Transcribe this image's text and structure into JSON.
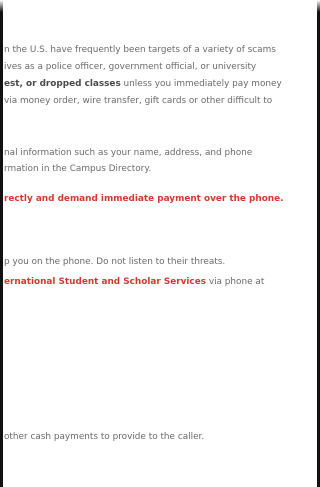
{
  "paragraph1": {
    "line1": "n the U.S. have frequently been targets of a variety of scams",
    "line2": "ives as a police officer, government official, or university",
    "line3_bold": "est, or dropped classes",
    "line3_rest": " unless you immediately pay money",
    "line4": "via money order, wire transfer, gift cards or other difficult to"
  },
  "paragraph2": {
    "line1": "nal information such as your name, address, and phone",
    "line2": "rmation in the Campus Directory."
  },
  "warning": {
    "text": "rectly and demand immediate payment over the phone."
  },
  "paragraph3": {
    "line1": "p you on the phone. Do not listen to their threats.",
    "line2_link": "ernational Student and Scholar Services",
    "line2_rest": " via phone at"
  },
  "paragraph4": {
    "line1": "other cash payments to provide to the caller."
  }
}
